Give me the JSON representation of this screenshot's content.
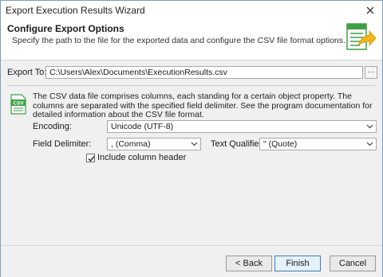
{
  "window": {
    "title": "Export Execution Results Wizard"
  },
  "header": {
    "title": "Configure Export Options",
    "description": "Specify the path to the file for the exported data and configure the CSV file format options."
  },
  "export_to": {
    "label": "Export To:",
    "value": "C:\\Users\\Alex\\Documents\\ExecutionResults.csv",
    "browse_label": "···"
  },
  "csv_info": {
    "icon_text": "CSV",
    "text": "The CSV data file comprises columns, each standing for a certain object property. The columns are separated with the specified field delimiter. See the program documentation for detailed information about the CSV file format."
  },
  "encoding": {
    "label": "Encoding:",
    "value": "Unicode (UTF-8)"
  },
  "field_delimiter": {
    "label": "Field Delimiter:",
    "value": ", (Comma)"
  },
  "text_qualifier": {
    "label": "Text Qualifier:",
    "value": "\" (Quote)"
  },
  "include_header": {
    "label": "Include column header",
    "checked": true
  },
  "footer": {
    "back_label": "< Back",
    "finish_label": "Finish",
    "cancel_label": "Cancel"
  },
  "colors": {
    "accent": "#3c7fb1",
    "icon_green": "#3f9f45",
    "icon_yellow": "#f2b61b"
  }
}
